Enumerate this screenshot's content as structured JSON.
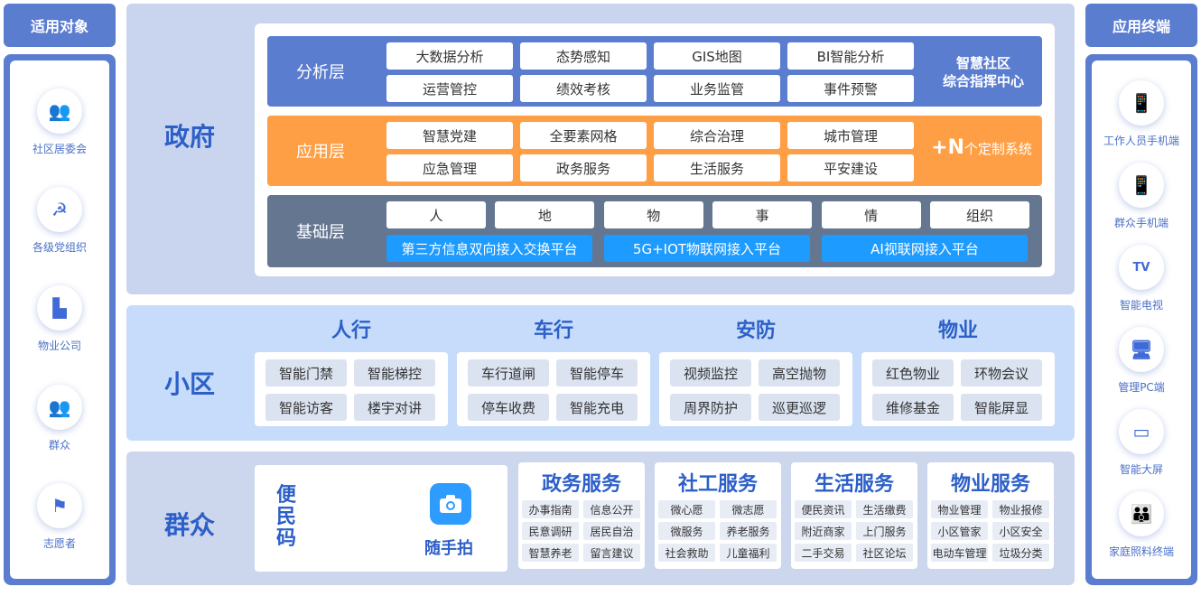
{
  "left_header": "适用对象",
  "right_header": "应用终端",
  "left_items": [
    {
      "label": "社区居委会",
      "icon": "people-group-icon",
      "glyph": "👥"
    },
    {
      "label": "各级党组织",
      "icon": "party-emblem-icon",
      "glyph": "☭"
    },
    {
      "label": "物业公司",
      "icon": "building-icon",
      "glyph": "▙"
    },
    {
      "label": "群众",
      "icon": "crowd-icon",
      "glyph": "👥"
    },
    {
      "label": "志愿者",
      "icon": "flag-icon",
      "glyph": "⚑"
    }
  ],
  "right_items": [
    {
      "label": "工作人员手机端",
      "icon": "mobile-app-icon",
      "glyph": "📱"
    },
    {
      "label": "群众手机端",
      "icon": "mobile-phone-icon",
      "glyph": "📱"
    },
    {
      "label": "智能电视",
      "icon": "tv-icon",
      "glyph": "TV"
    },
    {
      "label": "管理PC端",
      "icon": "pc-icon",
      "glyph": "🖥"
    },
    {
      "label": "智能大屏",
      "icon": "monitor-icon",
      "glyph": "▭"
    },
    {
      "label": "家庭照料终端",
      "icon": "family-care-icon",
      "glyph": "👪"
    }
  ],
  "government": {
    "title": "政府",
    "analysis": {
      "name": "分析层",
      "items": [
        "大数据分析",
        "态势感知",
        "GIS地图",
        "BI智能分析",
        "运营管控",
        "绩效考核",
        "业务监管",
        "事件预警"
      ],
      "side_line1": "智慧社区",
      "side_line2": "综合指挥中心"
    },
    "application": {
      "name": "应用层",
      "items": [
        "智慧党建",
        "全要素网格",
        "综合治理",
        "城市管理",
        "应急管理",
        "政务服务",
        "生活服务",
        "平安建设"
      ],
      "plus": "+N",
      "side_text": "个定制系统"
    },
    "base": {
      "name": "基础层",
      "items": [
        "人",
        "地",
        "物",
        "事",
        "情",
        "组织"
      ],
      "platforms": [
        "第三方信息双向接入交换平台",
        "5G+IOT物联网接入平台",
        "AI视联网接入平台"
      ]
    }
  },
  "community": {
    "title": "小区",
    "groups": [
      {
        "name": "人行",
        "items": [
          "智能门禁",
          "智能梯控",
          "智能访客",
          "楼宇对讲"
        ]
      },
      {
        "name": "车行",
        "items": [
          "车行道闸",
          "智能停车",
          "停车收费",
          "智能充电"
        ]
      },
      {
        "name": "安防",
        "items": [
          "视频监控",
          "高空抛物",
          "周界防护",
          "巡更巡逻"
        ]
      },
      {
        "name": "物业",
        "items": [
          "红色物业",
          "环物会议",
          "维修基金",
          "智能屏显"
        ]
      }
    ]
  },
  "public": {
    "title": "群众",
    "code_chars": [
      "便",
      "民",
      "码"
    ],
    "snap_label": "随手拍",
    "services": [
      {
        "name": "政务服务",
        "items": [
          "办事指南",
          "信息公开",
          "民意调研",
          "居民自治",
          "智慧养老",
          "留言建议"
        ]
      },
      {
        "name": "社工服务",
        "items": [
          "微心愿",
          "微志愿",
          "微服务",
          "养老服务",
          "社会救助",
          "儿童福利"
        ]
      },
      {
        "name": "生活服务",
        "items": [
          "便民资讯",
          "生活缴费",
          "附近商家",
          "上门服务",
          "二手交易",
          "社区论坛"
        ]
      },
      {
        "name": "物业服务",
        "items": [
          "物业管理",
          "物业报修",
          "小区管家",
          "小区安全",
          "电动车管理",
          "垃圾分类"
        ]
      }
    ]
  },
  "colors": {
    "accent": "#5b7dd0",
    "analysis": "#5b7dd0",
    "application": "#ff9f45",
    "base": "#657690",
    "platform": "#1e9bff",
    "gov_bg": "#c9d5ee",
    "community_bg": "#c6dcfa",
    "public_bg": "#ccd6ec"
  }
}
